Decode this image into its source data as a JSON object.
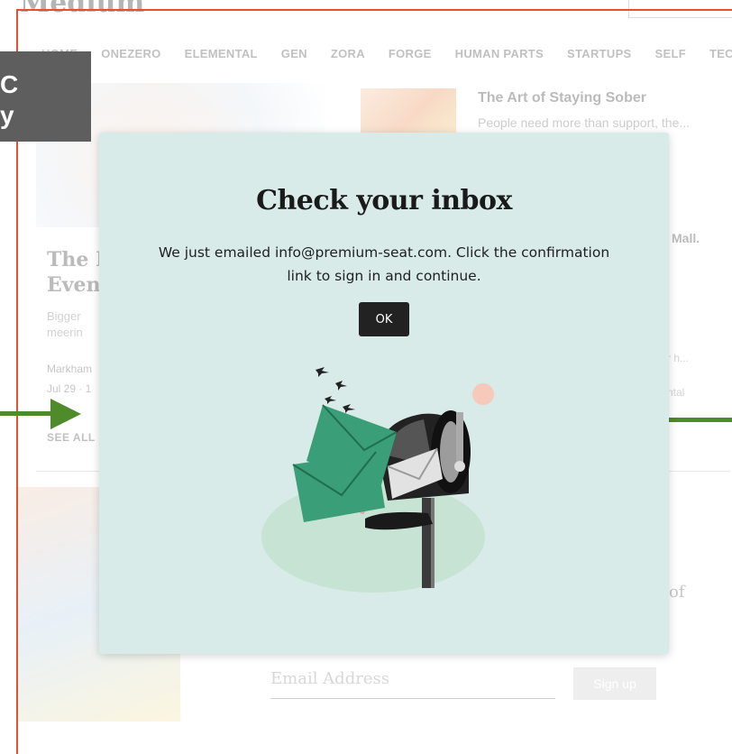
{
  "background_page": {
    "logo": "Medium",
    "nav_items": [
      "HOME",
      "ONEZERO",
      "ELEMENTAL",
      "GEN",
      "ZORA",
      "FORGE",
      "HUMAN PARTS",
      "STARTUPS",
      "SELF",
      "TECH"
    ],
    "headline_right": "The Art of Staying Sober",
    "subtext_right": "People need more than support, the...",
    "headline_left": [
      "The H",
      "Eveni"
    ],
    "text_left": [
      "Bigger",
      "meerin"
    ],
    "author_left": [
      "Markham",
      "Jul 29 · 1"
    ],
    "see_all": "SEE ALL",
    "right_fragment_a": "Mall.",
    "right_fragment_b": "r h...",
    "right_fragment_c": "ntal",
    "right_fragment_of": "of",
    "email_placeholder": "Email Address",
    "signup_label": "Sign up"
  },
  "grey_box_glyphs": "C\ny",
  "modal": {
    "title": "Check your inbox",
    "message": "We just emailed info@premium-seat.com. Click the confirmation link to sign in and continue.",
    "ok_label": "OK",
    "illustration": "mailbox-with-envelopes-icon"
  },
  "colors": {
    "modal_bg": "#d8ebe8",
    "button_bg": "#222222",
    "frame_red": "#e2522e",
    "arrow_green": "#4f8a2b",
    "envelope_green": "#3a9e78"
  }
}
